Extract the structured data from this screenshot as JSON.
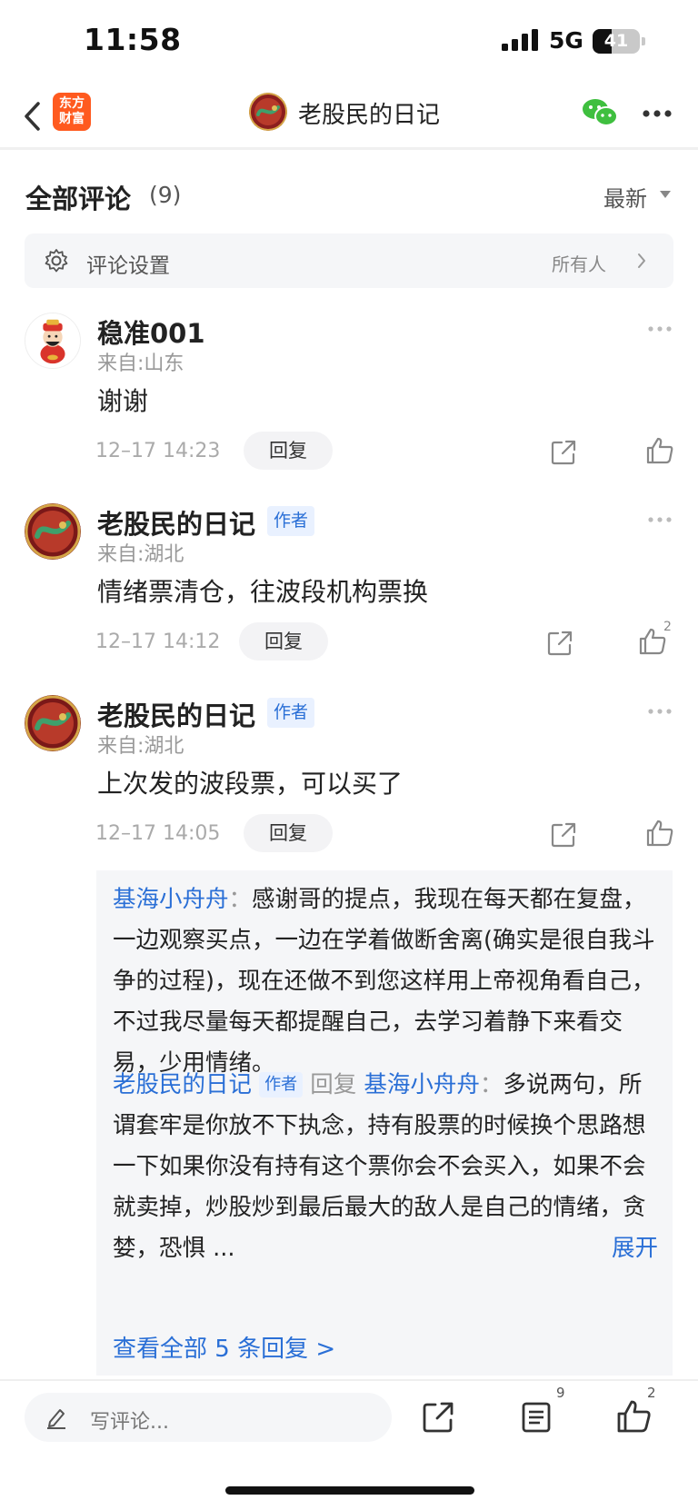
{
  "status_bar": {
    "time": "11:58",
    "network": "5G",
    "battery": "41",
    "battery_level_percent": 41
  },
  "nav": {
    "logo_line1": "东方",
    "logo_line2": "财富",
    "title": "老股民的日记"
  },
  "comments_header": {
    "title": "全部评论",
    "count": "(9)",
    "sort": "最新"
  },
  "settings": {
    "label": "评论设置",
    "value": "所有人"
  },
  "comments": [
    {
      "username": "稳准001",
      "location": "来自:山东",
      "text": "谢谢",
      "time": "12–17 14:23",
      "reply_label": "回复",
      "like_count": ""
    },
    {
      "username": "老股民的日记",
      "badge": "作者",
      "location": "来自:湖北",
      "text": "情绪票清仓，往波段机构票换",
      "time": "12–17 14:12",
      "reply_label": "回复",
      "like_count": "2"
    },
    {
      "username": "老股民的日记",
      "badge": "作者",
      "location": "来自:湖北",
      "text": "上次发的波段票，可以买了",
      "time": "12–17 14:05",
      "reply_label": "回复",
      "like_count": ""
    }
  ],
  "reply_thread": {
    "reply1": {
      "user": "基海小舟舟",
      "colon": "：",
      "text": "感谢哥的提点，我现在每天都在复盘，一边观察买点，一边在学着做断舍离(确实是很自我斗争的过程)，现在还做不到您这样用上帝视角看自己，不过我尽量每天都提醒自己，去学习着静下来看交易，少用情绪。"
    },
    "reply2": {
      "user": "老股民的日记",
      "badge": "作者",
      "reply_word": "回复",
      "target": "基海小舟舟",
      "colon": "：",
      "text": "多说两句，所谓套牢是你放不下执念，持有股票的时候换个思路想一下如果你没有持有这个票你会不会买入，如果不会就卖掉，炒股炒到最后最大的敌人是自己的情绪，贪婪，恐惧 ...",
      "expand": "展开"
    },
    "view_all": "查看全部 5 条回复 >"
  },
  "bottom_bar": {
    "placeholder": "写评论...",
    "list_count": "9",
    "like_count": "2"
  },
  "colors": {
    "accent_blue": "#2a6fd6",
    "logo_orange": "#ff5a1f",
    "wechat_green": "#3fbf3f"
  }
}
